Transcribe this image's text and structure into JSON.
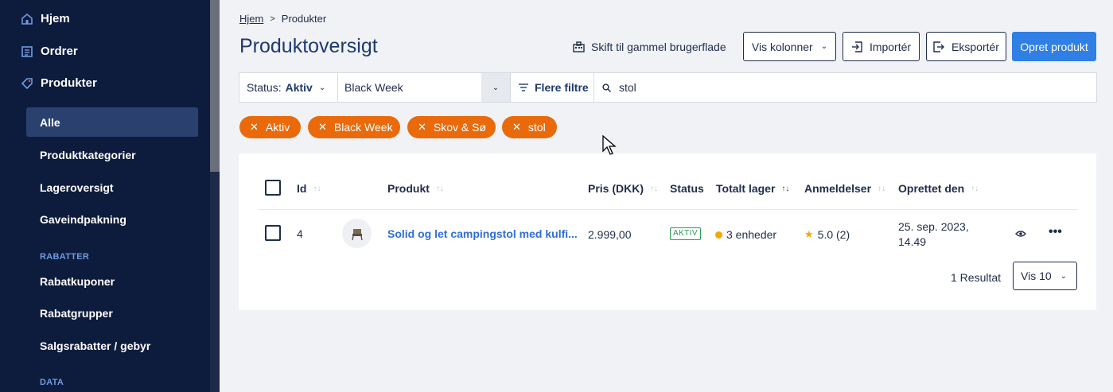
{
  "sidebar": {
    "top_items": [
      {
        "label": "Hjem",
        "icon": "home-icon"
      },
      {
        "label": "Ordrer",
        "icon": "orders-icon"
      },
      {
        "label": "Produkter",
        "icon": "tag-icon"
      }
    ],
    "product_sub": [
      "Alle",
      "Produktkategorier",
      "Lageroversigt",
      "Gaveindpakning"
    ],
    "sections": {
      "rabatter": "RABATTER",
      "data": "DATA"
    },
    "discount_sub": [
      "Rabatkuponer",
      "Rabatgrupper",
      "Salgsrabatter / gebyr"
    ],
    "active_item": "Alle"
  },
  "breadcrumb": {
    "home": "Hjem",
    "separator": ">",
    "current": "Produkter"
  },
  "page": {
    "title": "Produktoversigt"
  },
  "toolbar": {
    "old_ui_label": "Skift til gammel brugerflade",
    "columns_label": "Vis kolonner",
    "import_label": "Importér",
    "export_label": "Eksportér",
    "create_label": "Opret produkt"
  },
  "filters": {
    "status_key": "Status:",
    "status_value": "Aktiv",
    "campaign_value": "Black Week",
    "more_filters_label": "Flere filtre",
    "search_value": "stol"
  },
  "chips": [
    "Aktiv",
    "Black Week",
    "Skov & Sø",
    "stol"
  ],
  "table": {
    "columns": [
      "Id",
      "Produkt",
      "Pris (DKK)",
      "Status",
      "Totalt lager",
      "Anmeldelser",
      "Oprettet den"
    ],
    "rows": [
      {
        "id": "4",
        "product": "Solid og let campingstol med kulfi...",
        "price": "2.999,00",
        "status": "AKTIV",
        "stock": "3 enheder",
        "reviews": "5.0 (2)",
        "created_line1": "25. sep. 2023,",
        "created_line2": "14.49"
      }
    ],
    "result_count": "1 Resultat",
    "page_size_label": "Vis 10"
  },
  "colors": {
    "sidebar_bg": "#0d1b3d",
    "accent": "#2f7fe5",
    "chip": "#ea6a0b",
    "status_green": "#2e9b55",
    "stock_dot": "#f2a900"
  }
}
